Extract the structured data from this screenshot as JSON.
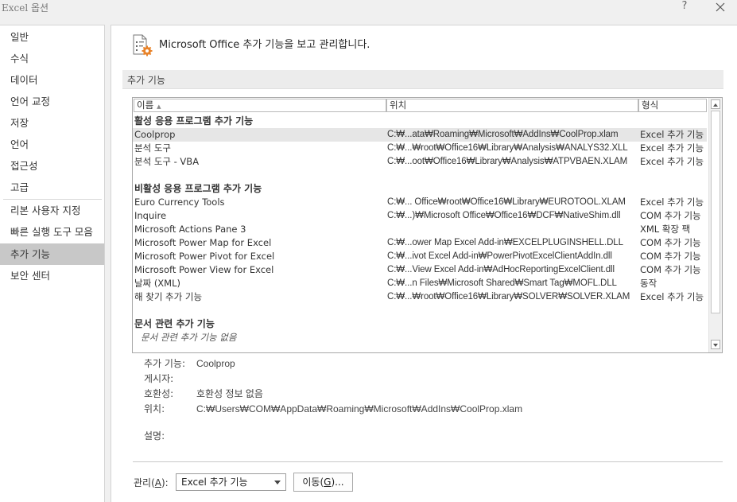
{
  "window": {
    "title": "Excel 옵션",
    "help_label": "?"
  },
  "nav": {
    "items": [
      {
        "label": "일반"
      },
      {
        "label": "수식"
      },
      {
        "label": "데이터"
      },
      {
        "label": "언어 교정"
      },
      {
        "label": "저장"
      },
      {
        "label": "언어"
      },
      {
        "label": "접근성"
      },
      {
        "label": "고급"
      },
      {
        "label": "리본 사용자 지정"
      },
      {
        "label": "빠른 실행 도구 모음"
      },
      {
        "label": "추가 기능"
      },
      {
        "label": "보안 센터"
      }
    ],
    "selected": "추가 기능"
  },
  "header": {
    "text": "Microsoft Office 추가 기능을 보고 관리합니다."
  },
  "section": {
    "title": "추가 기능"
  },
  "table": {
    "columns": [
      "이름",
      "위치",
      "형식"
    ],
    "sort_indicator": "▲",
    "groups": [
      {
        "title": "활성 응용 프로그램 추가 기능",
        "rows": [
          {
            "name": "Coolprop",
            "location": "C:₩...ata₩Roaming₩Microsoft₩AddIns₩CoolProp.xlam",
            "type": "Excel 추가 기능",
            "selected": true
          },
          {
            "name": "분석 도구",
            "location": "C:₩...₩root₩Office16₩Library₩Analysis₩ANALYS32.XLL",
            "type": "Excel 추가 기능"
          },
          {
            "name": "분석 도구 - VBA",
            "location": "C:₩...oot₩Office16₩Library₩Analysis₩ATPVBAEN.XLAM",
            "type": "Excel 추가 기능"
          }
        ]
      },
      {
        "title": "비활성 응용 프로그램 추가 기능",
        "rows": [
          {
            "name": "Euro Currency Tools",
            "location": "C:₩... Office₩root₩Office16₩Library₩EUROTOOL.XLAM",
            "type": "Excel 추가 기능"
          },
          {
            "name": "Inquire",
            "location": "C:₩...)₩Microsoft Office₩Office16₩DCF₩NativeShim.dll",
            "type": "COM 추가 기능"
          },
          {
            "name": "Microsoft Actions Pane 3",
            "location": "",
            "type": "XML 확장 팩"
          },
          {
            "name": "Microsoft Power Map for Excel",
            "location": "C:₩...ower Map Excel Add-in₩EXCELPLUGINSHELL.DLL",
            "type": "COM 추가 기능"
          },
          {
            "name": "Microsoft Power Pivot for Excel",
            "location": "C:₩...ivot Excel Add-in₩PowerPivotExcelClientAddIn.dll",
            "type": "COM 추가 기능"
          },
          {
            "name": "Microsoft Power View for Excel",
            "location": "C:₩...View Excel Add-in₩AdHocReportingExcelClient.dll",
            "type": "COM 추가 기능"
          },
          {
            "name": "날짜 (XML)",
            "location": "C:₩...n Files₩Microsoft Shared₩Smart Tag₩MOFL.DLL",
            "type": "동작"
          },
          {
            "name": "해 찾기 추가 기능",
            "location": "C:₩...₩root₩Office16₩Library₩SOLVER₩SOLVER.XLAM",
            "type": "Excel 추가 기능"
          }
        ]
      },
      {
        "title": "문서 관련 추가 기능",
        "empty_text": "문서 관련 추가 기능 없음",
        "rows": []
      }
    ]
  },
  "details": {
    "addin_label": "추가 기능:",
    "addin_value": "Coolprop",
    "publisher_label": "게시자:",
    "publisher_value": "",
    "compat_label": "호환성:",
    "compat_value": "호환성 정보 없음",
    "location_label": "위치:",
    "location_value": "C:₩Users₩COM₩AppData₩Roaming₩Microsoft₩AddIns₩CoolProp.xlam",
    "description_label": "설명:",
    "description_value": ""
  },
  "manage": {
    "label_prefix": "관리(",
    "label_key": "A",
    "label_suffix": "):",
    "selected": "Excel 추가 기능",
    "go_prefix": "이동(",
    "go_key": "G",
    "go_suffix": ")..."
  },
  "colors": {
    "selected_nav": "#c8c8c8",
    "selected_row": "#e6e6e6",
    "icon_accent": "#e8832a"
  },
  "icons": {
    "close": "close-icon",
    "header": "addins-gear-icon"
  }
}
